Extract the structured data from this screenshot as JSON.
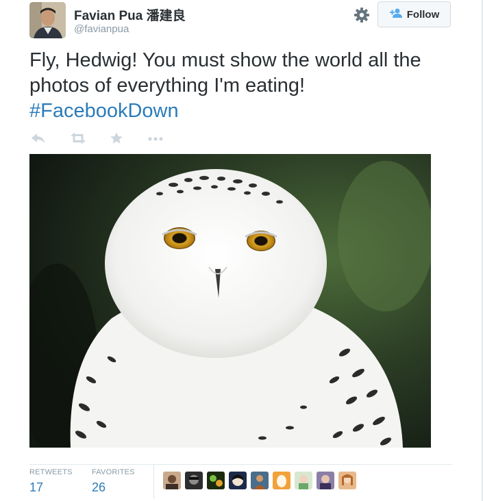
{
  "tweet": {
    "author_name": "Favian Pua 潘建良",
    "author_handle": "@favianpua",
    "text_main": "Fly, Hedwig! You must show the world all the photos of everything I'm eating!",
    "hashtag": "#FacebookDown",
    "follow_label": "Follow",
    "image_description": "Snowy owl"
  },
  "actions": [
    {
      "icon": "reply-icon"
    },
    {
      "icon": "retweet-icon"
    },
    {
      "icon": "favorite-star-icon"
    },
    {
      "icon": "more-icon"
    }
  ],
  "stats": {
    "retweets_label": "RETWEETS",
    "retweets_count": "17",
    "favorites_label": "FAVORITES",
    "favorites_count": "26"
  },
  "favorited_by_count": 9,
  "colors": {
    "link": "#2b7bb9",
    "muted": "#8899a6",
    "text": "#292f33",
    "action_icon": "#ccd6dd"
  }
}
